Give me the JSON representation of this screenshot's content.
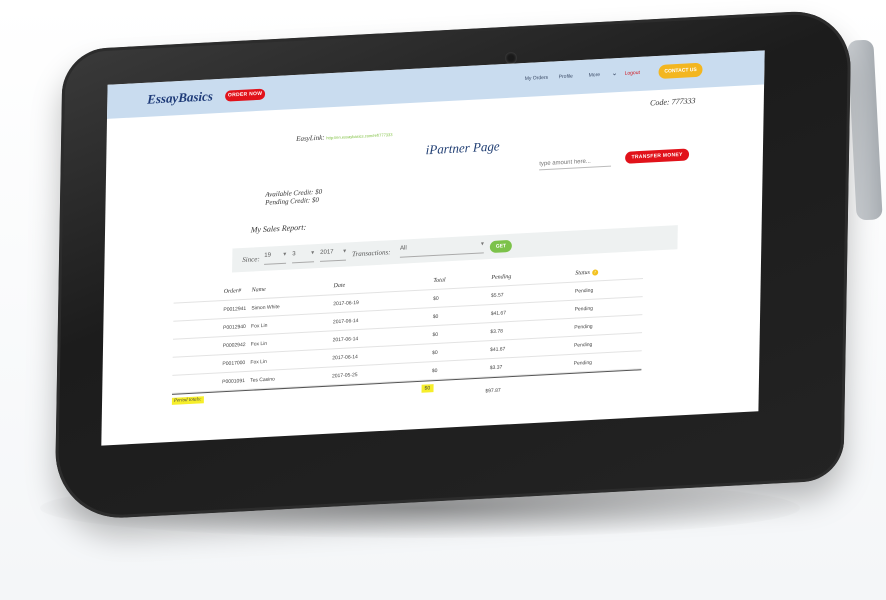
{
  "header": {
    "logo": "EssayBasics",
    "order_button": "ORDER NOW",
    "nav": {
      "orders": "My Orders",
      "profile": "Profile",
      "more": "More",
      "logout": "Logout",
      "contact": "Contact Us"
    },
    "contact_button": "CONTACT US"
  },
  "code_label": "Code: 777333",
  "easylink": {
    "label": "EasyLink:",
    "url": "http://en.essaybasics.com/ref/777333"
  },
  "page_title": "iPartner Page",
  "transfer": {
    "placeholder": "type amount here...",
    "button": "TRANSFER MONEY"
  },
  "credit": {
    "available": "Available Credit: $0",
    "pending": "Pending Credit: $0"
  },
  "sales_report_label": "My Sales Report:",
  "filter": {
    "since_label": "Since:",
    "day": "19",
    "month": "3",
    "year": "2017",
    "transactions_label": "Transactions:",
    "transactions_value": "All",
    "get_button": "GET"
  },
  "table": {
    "columns": [
      "Order#",
      "Name",
      "Date",
      "Total",
      "Pending",
      "Status"
    ],
    "rows": [
      {
        "order": "P0012941",
        "name": "Simon White",
        "date": "2017-06-19",
        "total": "$0",
        "pending": "$5.57",
        "status": "Pending"
      },
      {
        "order": "P0012940",
        "name": "Fox Lin",
        "date": "2017-06-14",
        "total": "$0",
        "pending": "$41.67",
        "status": "Pending"
      },
      {
        "order": "P0002942",
        "name": "Fox Lin",
        "date": "2017-06-14",
        "total": "$0",
        "pending": "$3.78",
        "status": "Pending"
      },
      {
        "order": "P0017000",
        "name": "Fox Lin",
        "date": "2017-06-14",
        "total": "$0",
        "pending": "$41.67",
        "status": "Pending"
      },
      {
        "order": "P0001091",
        "name": "Tes Casino",
        "date": "2017-05-25",
        "total": "$0",
        "pending": "$3.37",
        "status": "Pending"
      }
    ],
    "totals": {
      "label": "Period totals:",
      "total": "$0",
      "pending": "$97.87"
    }
  },
  "colors": {
    "header_bg": "#c9dcef",
    "brand_blue": "#1f3d72",
    "accent_red": "#e1121a",
    "accent_yellow": "#f3b61f",
    "accent_green": "#7cc24a"
  }
}
